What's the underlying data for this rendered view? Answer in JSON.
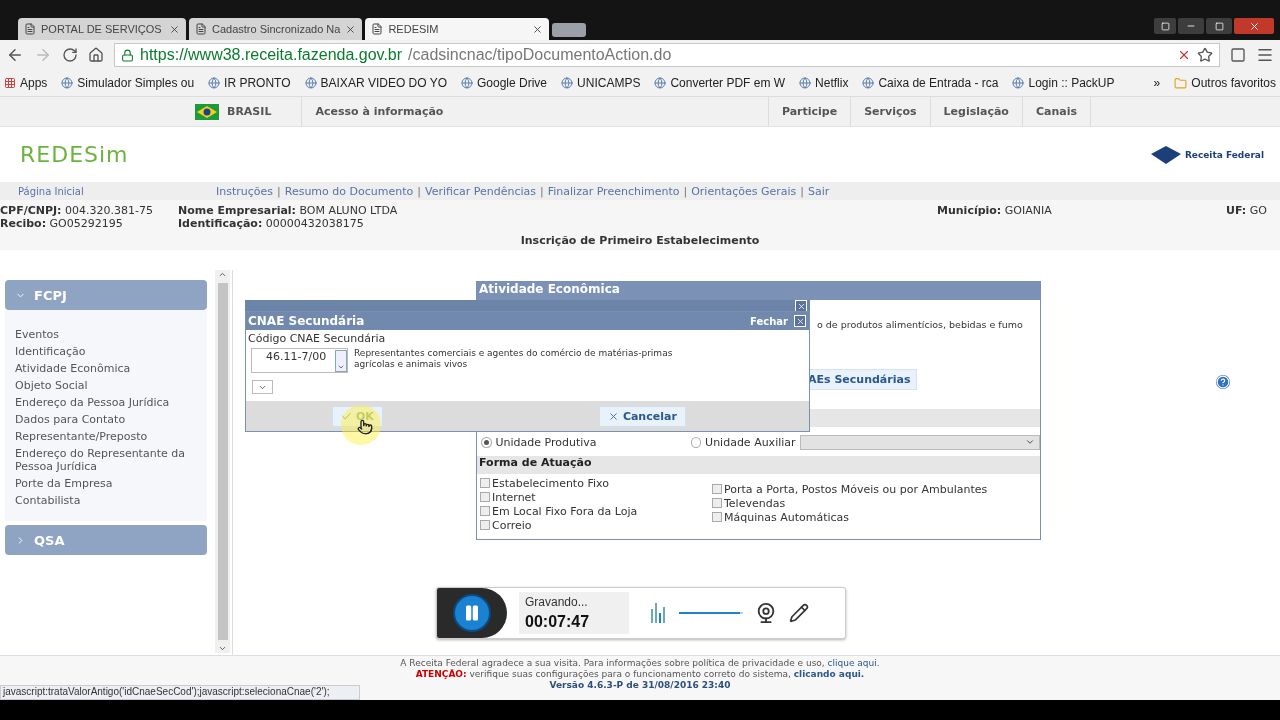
{
  "browser": {
    "tabs": [
      {
        "title": "PORTAL DE SERVIÇOS",
        "selected": false
      },
      {
        "title": "Cadastro Sincronizado Na",
        "selected": false
      },
      {
        "title": "REDESIM",
        "selected": true
      }
    ],
    "url_host": "https://www38.receita.fazenda.gov.br",
    "url_path": "/cadsincnac/tipoDocumentoAction.do",
    "bookmarks": [
      "Apps",
      "Simulador Simples ou",
      "IR PRONTO",
      "BAIXAR VIDEO DO YO",
      "Google Drive",
      "UNICAMPS",
      "Converter PDF em W",
      "Netflix",
      "Caixa de Entrada - rca",
      "Login :: PackUP"
    ],
    "more": "»",
    "other_bookmarks": "Outros favoritos"
  },
  "gov_bar": {
    "country": "BRASIL",
    "access": "Acesso à informação",
    "links": [
      "Participe",
      "Serviços",
      "Legislação",
      "Canais"
    ]
  },
  "header": {
    "logo": "REDESim",
    "brand": "Receita Federal"
  },
  "nav": {
    "home": "Página Inicial",
    "separator": "|",
    "links": [
      "Instruções",
      "Resumo do Documento",
      "Verificar Pendências",
      "Finalizar Preenchimento",
      "Orientações Gerais",
      "Sair"
    ]
  },
  "info": {
    "rows": [
      [
        {
          "label": "CPF/CNPJ:",
          "value": "004.320.381-75"
        },
        {
          "label": "Nome Empresarial:",
          "value": "BOM ALUNO LTDA"
        },
        {
          "label": "Município:",
          "value": "GOIANIA"
        },
        {
          "label": "UF:",
          "value": "GO"
        }
      ],
      [
        {
          "label": "Recibo:",
          "value": "GO05292195"
        },
        {
          "label": "Identificação:",
          "value": "00000432038175"
        }
      ]
    ],
    "title": "Inscrição de Primeiro Estabelecimento"
  },
  "sidebar": [
    {
      "title": "FCPJ",
      "expanded": true,
      "items": [
        "Eventos",
        "Identificação",
        "Atividade Econômica",
        "Objeto Social",
        "Endereço da Pessoa Jurídica",
        "Dados para Contato",
        "Representante/Preposto",
        "Endereço do Representante da Pessoa Jurídica",
        "Porte da Empresa",
        "Contabilista"
      ]
    },
    {
      "title": "QSA",
      "expanded": false
    }
  ],
  "panel": {
    "title": "Atividade Econômica",
    "fragment": "o de produtos alimentícios, bebidas e fumo",
    "button": "AEs Secundárias",
    "units": [
      {
        "label": "Unidade Produtiva",
        "selected": true
      },
      {
        "label": "Unidade Auxiliar",
        "selected": false
      }
    ],
    "forma_title": "Forma de Atuação",
    "forma_left": [
      {
        "label": "Estabelecimento Fixo",
        "checked": false
      },
      {
        "label": "Internet",
        "checked": false
      },
      {
        "label": "Em Local Fixo Fora da Loja",
        "checked": false
      },
      {
        "label": "Correio",
        "checked": false
      }
    ],
    "forma_right": [
      {
        "label": "Porta a Porta, Postos Móveis ou por Ambulantes",
        "checked": false
      },
      {
        "label": "Televendas",
        "checked": false
      },
      {
        "label": "Máquinas Automáticas",
        "checked": false
      }
    ]
  },
  "dialog": {
    "title": "CNAE Secundária",
    "close": "Fechar",
    "field_label": "Código CNAE Secundária",
    "code": "46.11-7/00",
    "description": "Representantes comerciais e agentes do comércio de matérias-primas agrícolas e animais vivos",
    "ok": "OK",
    "cancel": "Cancelar"
  },
  "recorder": {
    "status": "Gravando...",
    "time": "00:07:47",
    "volume": {
      "level": 0.95
    }
  },
  "footer": {
    "line1": {
      "text": "A Receita Federal agradece a sua visita. Para informações sobre política de privacidade e uso,",
      "link": "clique aqui."
    },
    "line2": {
      "label": "ATENÇÃO:",
      "text": "verifique suas configurações para o funcionamento correto do sistema,",
      "link": "clicando aqui."
    },
    "version": "Versão 4.6.3-P de 31/08/2016 23:40"
  },
  "status_bar": "javascript:trataValorAntigo('idCnaeSecCod');javascript:selecionaCnae('2');"
}
